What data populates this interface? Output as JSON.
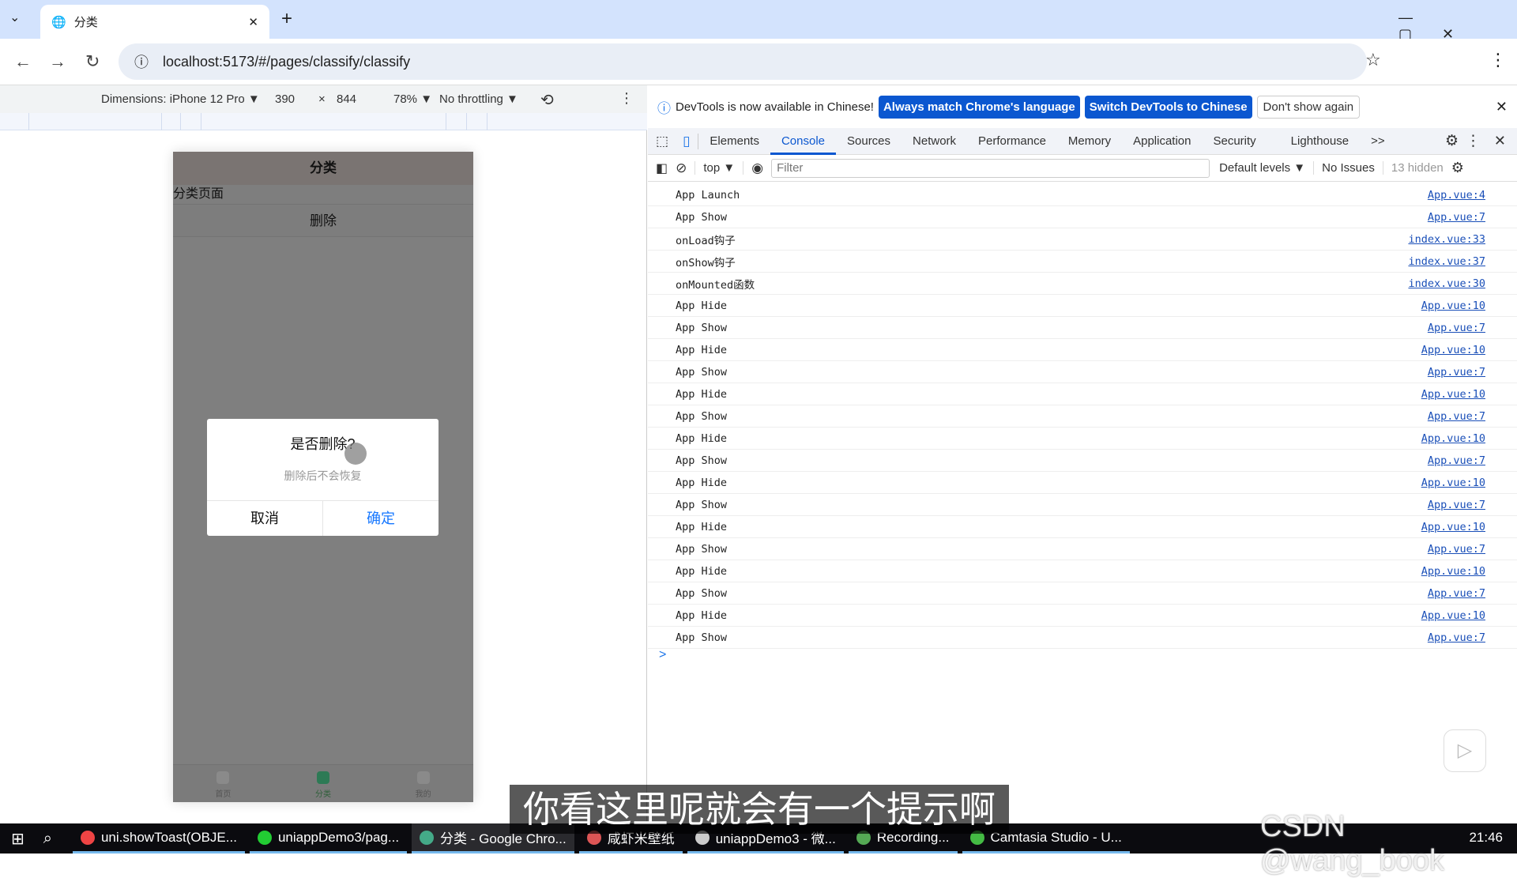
{
  "browser": {
    "tab_title": "分类",
    "url": "localhost:5173/#/pages/classify/classify",
    "new_tab": "+",
    "close": "✕"
  },
  "device_toolbar": {
    "dimensions": "Dimensions: iPhone 12 Pro ▼",
    "width": "390",
    "times": "×",
    "height": "844",
    "zoom": "78% ▼",
    "throttling": "No throttling ▼"
  },
  "phone": {
    "nav_title": "分类",
    "page_text": "分类页面",
    "delete_button": "删除",
    "tabbar": [
      {
        "label": "首页"
      },
      {
        "label": "分类",
        "active": true
      },
      {
        "label": "我的"
      }
    ],
    "dialog": {
      "title": "是否删除?",
      "content": "删除后不会恢复",
      "cancel": "取消",
      "confirm": "确定",
      "confirm_color": "#1677ff"
    }
  },
  "devtools": {
    "info": {
      "message": "DevTools is now available in Chinese!",
      "btn_match": "Always match Chrome's language",
      "btn_switch": "Switch DevTools to Chinese",
      "btn_dont": "Don't show again"
    },
    "tabs": [
      "Elements",
      "Console",
      "Sources",
      "Network",
      "Performance",
      "Memory",
      "Application",
      "Security",
      "Lighthouse"
    ],
    "active_tab": "Console",
    "more": ">>",
    "console_toolbar": {
      "context": "top ▼",
      "filter_placeholder": "Filter",
      "levels": "Default levels ▼",
      "issues": "No Issues",
      "hidden": "13 hidden"
    },
    "logs": [
      {
        "msg": "App Launch",
        "src": "App.vue:4"
      },
      {
        "msg": "App Show",
        "src": "App.vue:7"
      },
      {
        "msg": "onLoad钩子",
        "src": "index.vue:33"
      },
      {
        "msg": "onShow钩子",
        "src": "index.vue:37"
      },
      {
        "msg": "onMounted函数",
        "src": "index.vue:30"
      },
      {
        "msg": "App Hide",
        "src": "App.vue:10"
      },
      {
        "msg": "App Show",
        "src": "App.vue:7"
      },
      {
        "msg": "App Hide",
        "src": "App.vue:10"
      },
      {
        "msg": "App Show",
        "src": "App.vue:7"
      },
      {
        "msg": "App Hide",
        "src": "App.vue:10"
      },
      {
        "msg": "App Show",
        "src": "App.vue:7"
      },
      {
        "msg": "App Hide",
        "src": "App.vue:10"
      },
      {
        "msg": "App Show",
        "src": "App.vue:7"
      },
      {
        "msg": "App Hide",
        "src": "App.vue:10"
      },
      {
        "msg": "App Show",
        "src": "App.vue:7"
      },
      {
        "msg": "App Hide",
        "src": "App.vue:10"
      },
      {
        "msg": "App Show",
        "src": "App.vue:7"
      },
      {
        "msg": "App Hide",
        "src": "App.vue:10"
      },
      {
        "msg": "App Show",
        "src": "App.vue:7"
      },
      {
        "msg": "App Hide",
        "src": "App.vue:10"
      },
      {
        "msg": "App Show",
        "src": "App.vue:7"
      }
    ],
    "prompt": ">"
  },
  "taskbar": {
    "items": [
      {
        "label": "uni.showToast(OBJE...",
        "color": "#e44"
      },
      {
        "label": "uniappDemo3/pag...",
        "color": "#2c3"
      },
      {
        "label": "分类 - Google Chro...",
        "color": "#4a8"
      },
      {
        "label": "咸虾米壁纸",
        "color": "#d55"
      },
      {
        "label": "uniappDemo3 - 微...",
        "color": "#ccc"
      },
      {
        "label": "Recording...",
        "color": "#5a5"
      },
      {
        "label": "Camtasia Studio - U...",
        "color": "#4b4"
      }
    ],
    "clock": "21:46"
  },
  "overlay": {
    "subtitle": "你看这里呢就会有一个提示啊",
    "watermark": "CSDN @wang_book"
  }
}
